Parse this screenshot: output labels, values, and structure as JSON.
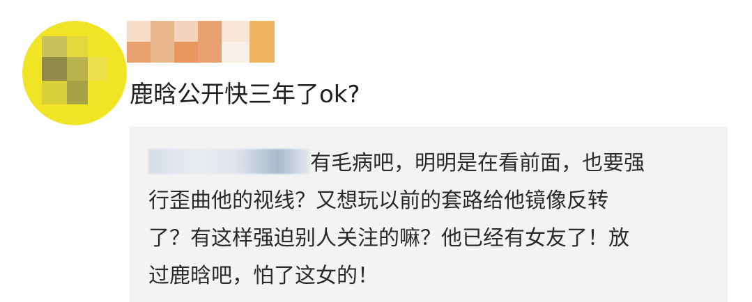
{
  "comment": {
    "username": "",
    "text": "鹿晗公开快三年了ok?"
  },
  "quoted_reply": {
    "lines": [
      "有毛病吧，明明是在看前面，也要强",
      "行歪曲他的视线？又想玩以前的套路给他镜像反转",
      "了？有这样强迫别人关注的嘛？他已经有女友了！放",
      "过鹿晗吧，怕了这女的！"
    ]
  },
  "colors": {
    "avatar_bg": "#f1e424",
    "quote_bg": "#f3f3f3",
    "text": "#1e1e1e"
  }
}
